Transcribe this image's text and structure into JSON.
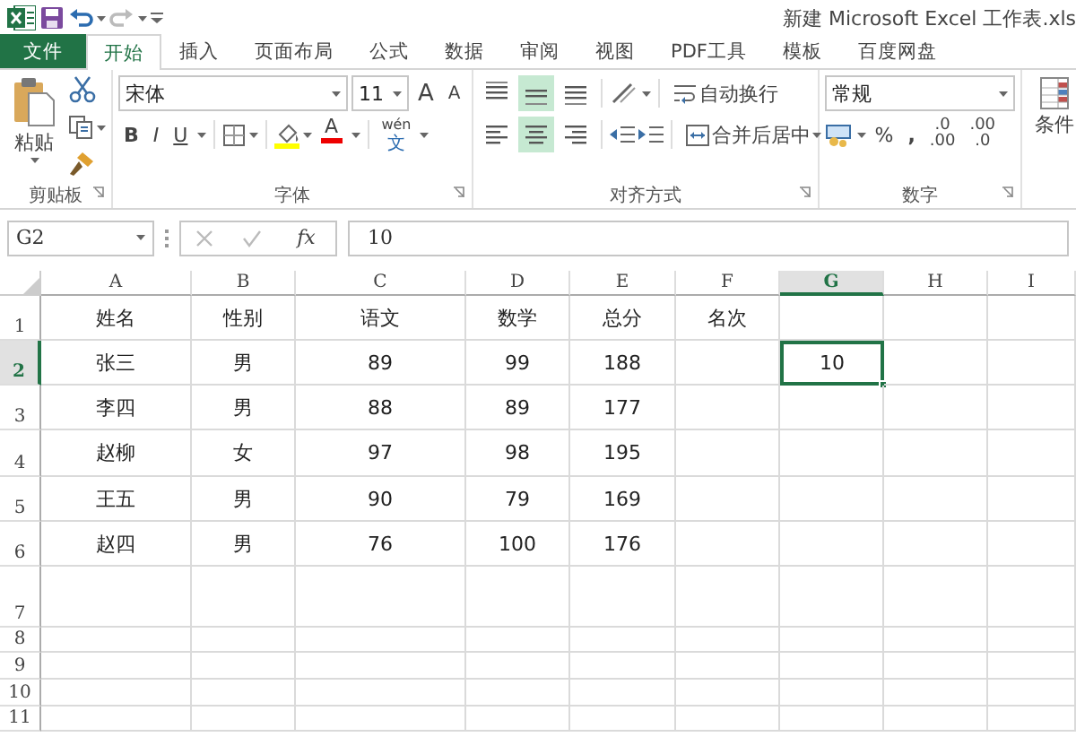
{
  "window": {
    "title": "新建 Microsoft Excel 工作表.xls"
  },
  "tabs": [
    {
      "label": "文件",
      "kind": "file",
      "selected": false
    },
    {
      "label": "开始",
      "kind": "tab",
      "selected": true
    },
    {
      "label": "插入",
      "kind": "tab",
      "selected": false
    },
    {
      "label": "页面布局",
      "kind": "tab",
      "selected": false
    },
    {
      "label": "公式",
      "kind": "tab",
      "selected": false
    },
    {
      "label": "数据",
      "kind": "tab",
      "selected": false
    },
    {
      "label": "审阅",
      "kind": "tab",
      "selected": false
    },
    {
      "label": "视图",
      "kind": "tab",
      "selected": false
    },
    {
      "label": "PDF工具",
      "kind": "tab",
      "selected": false
    },
    {
      "label": "模板",
      "kind": "tab",
      "selected": false
    },
    {
      "label": "百度网盘",
      "kind": "tab",
      "selected": false
    }
  ],
  "ribbon": {
    "clipboard": {
      "paste": "粘贴",
      "label": "剪贴板"
    },
    "font": {
      "name": "宋体",
      "size": "11",
      "grow": "A",
      "shrink": "A",
      "bold": "B",
      "italic": "I",
      "underline": "U",
      "font_color": "A",
      "phonetic": "wén",
      "phonetic_char": "文",
      "label": "字体"
    },
    "alignment": {
      "vertical": [
        {
          "kind": "top",
          "selected": false
        },
        {
          "kind": "middle",
          "selected": true
        },
        {
          "kind": "bottom",
          "selected": false
        }
      ],
      "horizontal": [
        {
          "kind": "left",
          "selected": false
        },
        {
          "kind": "center",
          "selected": true
        },
        {
          "kind": "right",
          "selected": false
        }
      ],
      "wrap": "自动换行",
      "merge": "合并后居中",
      "label": "对齐方式"
    },
    "number": {
      "format": "常规",
      "percent": "%",
      "comma": ",",
      "increase_decimal": [
        ".0",
        ".00"
      ],
      "decrease_decimal": [
        ".00",
        ".0"
      ],
      "label": "数字"
    },
    "styles": {
      "conditional": "条件"
    }
  },
  "formula_bar": {
    "name_box": "G2",
    "fx": "fx",
    "value": "10"
  },
  "sheet": {
    "columns": [
      {
        "label": "A",
        "selected": false
      },
      {
        "label": "B",
        "selected": false
      },
      {
        "label": "C",
        "selected": false
      },
      {
        "label": "D",
        "selected": false
      },
      {
        "label": "E",
        "selected": false
      },
      {
        "label": "F",
        "selected": false
      },
      {
        "label": "G",
        "selected": true
      },
      {
        "label": "H",
        "selected": false
      },
      {
        "label": "I",
        "selected": false
      }
    ],
    "rows": [
      {
        "label": "1",
        "selected": false,
        "cells": [
          "姓名",
          "性别",
          "语文",
          "数学",
          "总分",
          "名次"
        ]
      },
      {
        "label": "2",
        "selected": true,
        "cells": [
          "张三",
          "男",
          "89",
          "99",
          "188",
          "",
          "10"
        ]
      },
      {
        "label": "3",
        "selected": false,
        "cells": [
          "李四",
          "男",
          "88",
          "89",
          "177"
        ]
      },
      {
        "label": "4",
        "selected": false,
        "cells": [
          "赵柳",
          "女",
          "97",
          "98",
          "195"
        ]
      },
      {
        "label": "5",
        "selected": false,
        "cells": [
          "王五",
          "男",
          "90",
          "79",
          "169"
        ]
      },
      {
        "label": "6",
        "selected": false,
        "cells": [
          "赵四",
          "男",
          "76",
          "100",
          "176"
        ]
      },
      {
        "label": "7",
        "selected": false,
        "cells": []
      },
      {
        "label": "8",
        "selected": false,
        "cells": []
      },
      {
        "label": "9",
        "selected": false,
        "cells": []
      },
      {
        "label": "10",
        "selected": false,
        "cells": []
      },
      {
        "label": "11",
        "selected": false,
        "cells": []
      }
    ]
  }
}
